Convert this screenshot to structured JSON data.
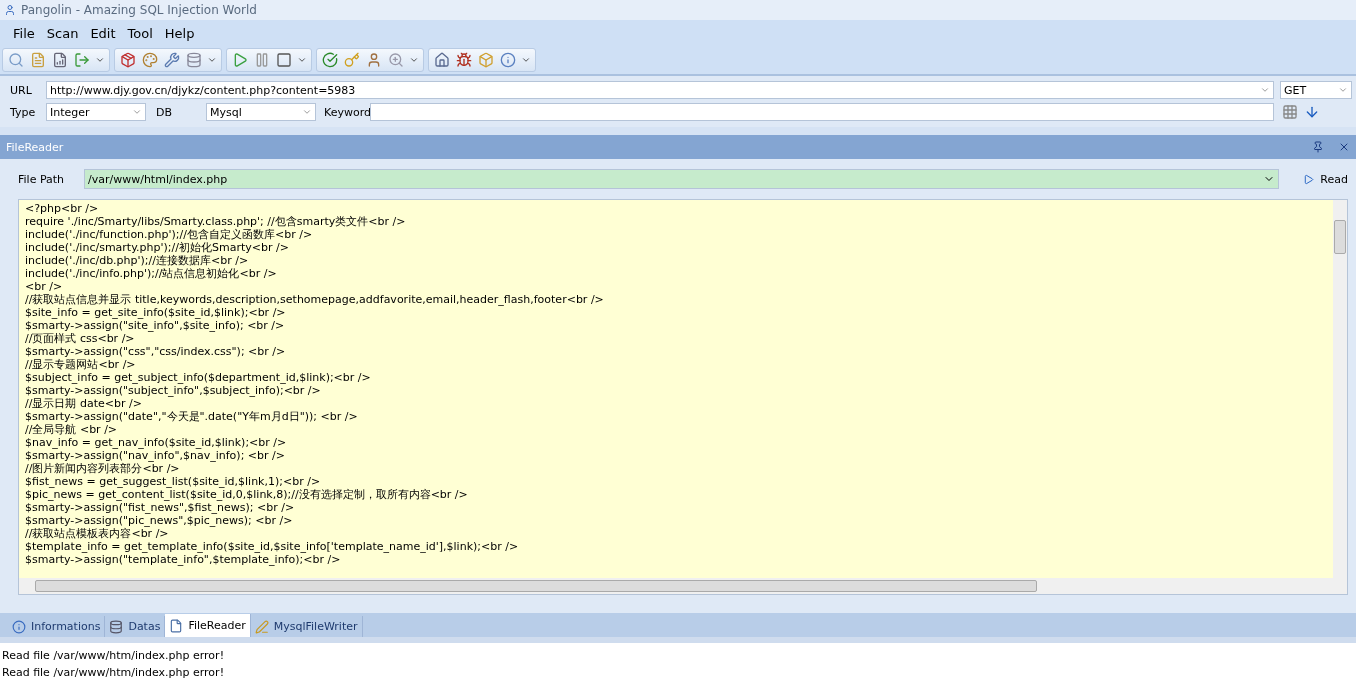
{
  "window": {
    "title": "Pangolin - Amazing SQL Injection World"
  },
  "menu": [
    "File",
    "Scan",
    "Edit",
    "Tool",
    "Help"
  ],
  "form": {
    "url_label": "URL",
    "url": "http://www.djy.gov.cn/djykz/content.php?content=5983",
    "method": "GET",
    "type_label": "Type",
    "type": "Integer",
    "db_label": "DB",
    "db": "Mysql",
    "keyword_label": "Keyword"
  },
  "panel": {
    "title": "FileReader",
    "file_path_label": "File Path",
    "file_path": "/var/www/html/index.php",
    "read_button": "Read"
  },
  "code_lines": [
    "<?php<br />",
    "require './inc/Smarty/libs/Smarty.class.php'; //包含smarty类文件<br />",
    "include('./inc/function.php');//包含自定义函数库<br />",
    "include('./inc/smarty.php');//初始化Smarty<br />",
    "include('./inc/db.php');//连接数据库<br />",
    "include('./inc/info.php');//站点信息初始化<br />",
    "<br />",
    "//获取站点信息并显示 title,keywords,description,sethomepage,addfavorite,email,header_flash,footer<br />",
    "$site_info = get_site_info($site_id,$link);<br />",
    "$smarty->assign(\"site_info\",$site_info); <br />",
    "//页面样式 css<br />",
    "$smarty->assign(\"css\",\"css/index.css\"); <br />",
    "//显示专题网站<br />",
    "$subject_info = get_subject_info($department_id,$link);<br />",
    "$smarty->assign(\"subject_info\",$subject_info);<br />",
    "//显示日期 date<br />",
    "$smarty->assign(\"date\",\"今天是\".date(\"Y年m月d日\")); <br />",
    "//全局导航 <br />",
    "$nav_info = get_nav_info($site_id,$link);<br />",
    "$smarty->assign(\"nav_info\",$nav_info); <br />",
    "//图片新闻内容列表部分<br />",
    "$fist_news = get_suggest_list($site_id,$link,1);<br />",
    "$pic_news = get_content_list($site_id,0,$link,8);//没有选择定制，取所有内容<br />",
    "$smarty->assign(\"fist_news\",$fist_news); <br />",
    "$smarty->assign(\"pic_news\",$pic_news); <br />",
    "//获取站点模板表内容<br />",
    "$template_info = get_template_info($site_id,$site_info['template_name_id'],$link);<br />",
    "$smarty->assign(\"template_info\",$template_info);<br />"
  ],
  "tabs": [
    {
      "label": "Informations",
      "kind": "info",
      "selected": false
    },
    {
      "label": "Datas",
      "kind": "db",
      "selected": false
    },
    {
      "label": "FileReader",
      "kind": "file",
      "selected": true
    },
    {
      "label": "MysqlFileWriter",
      "kind": "writer",
      "selected": false
    }
  ],
  "log": [
    "Read file /var/www/htm/index.php error!",
    "Read file /var/www/htm/index.php error!"
  ]
}
